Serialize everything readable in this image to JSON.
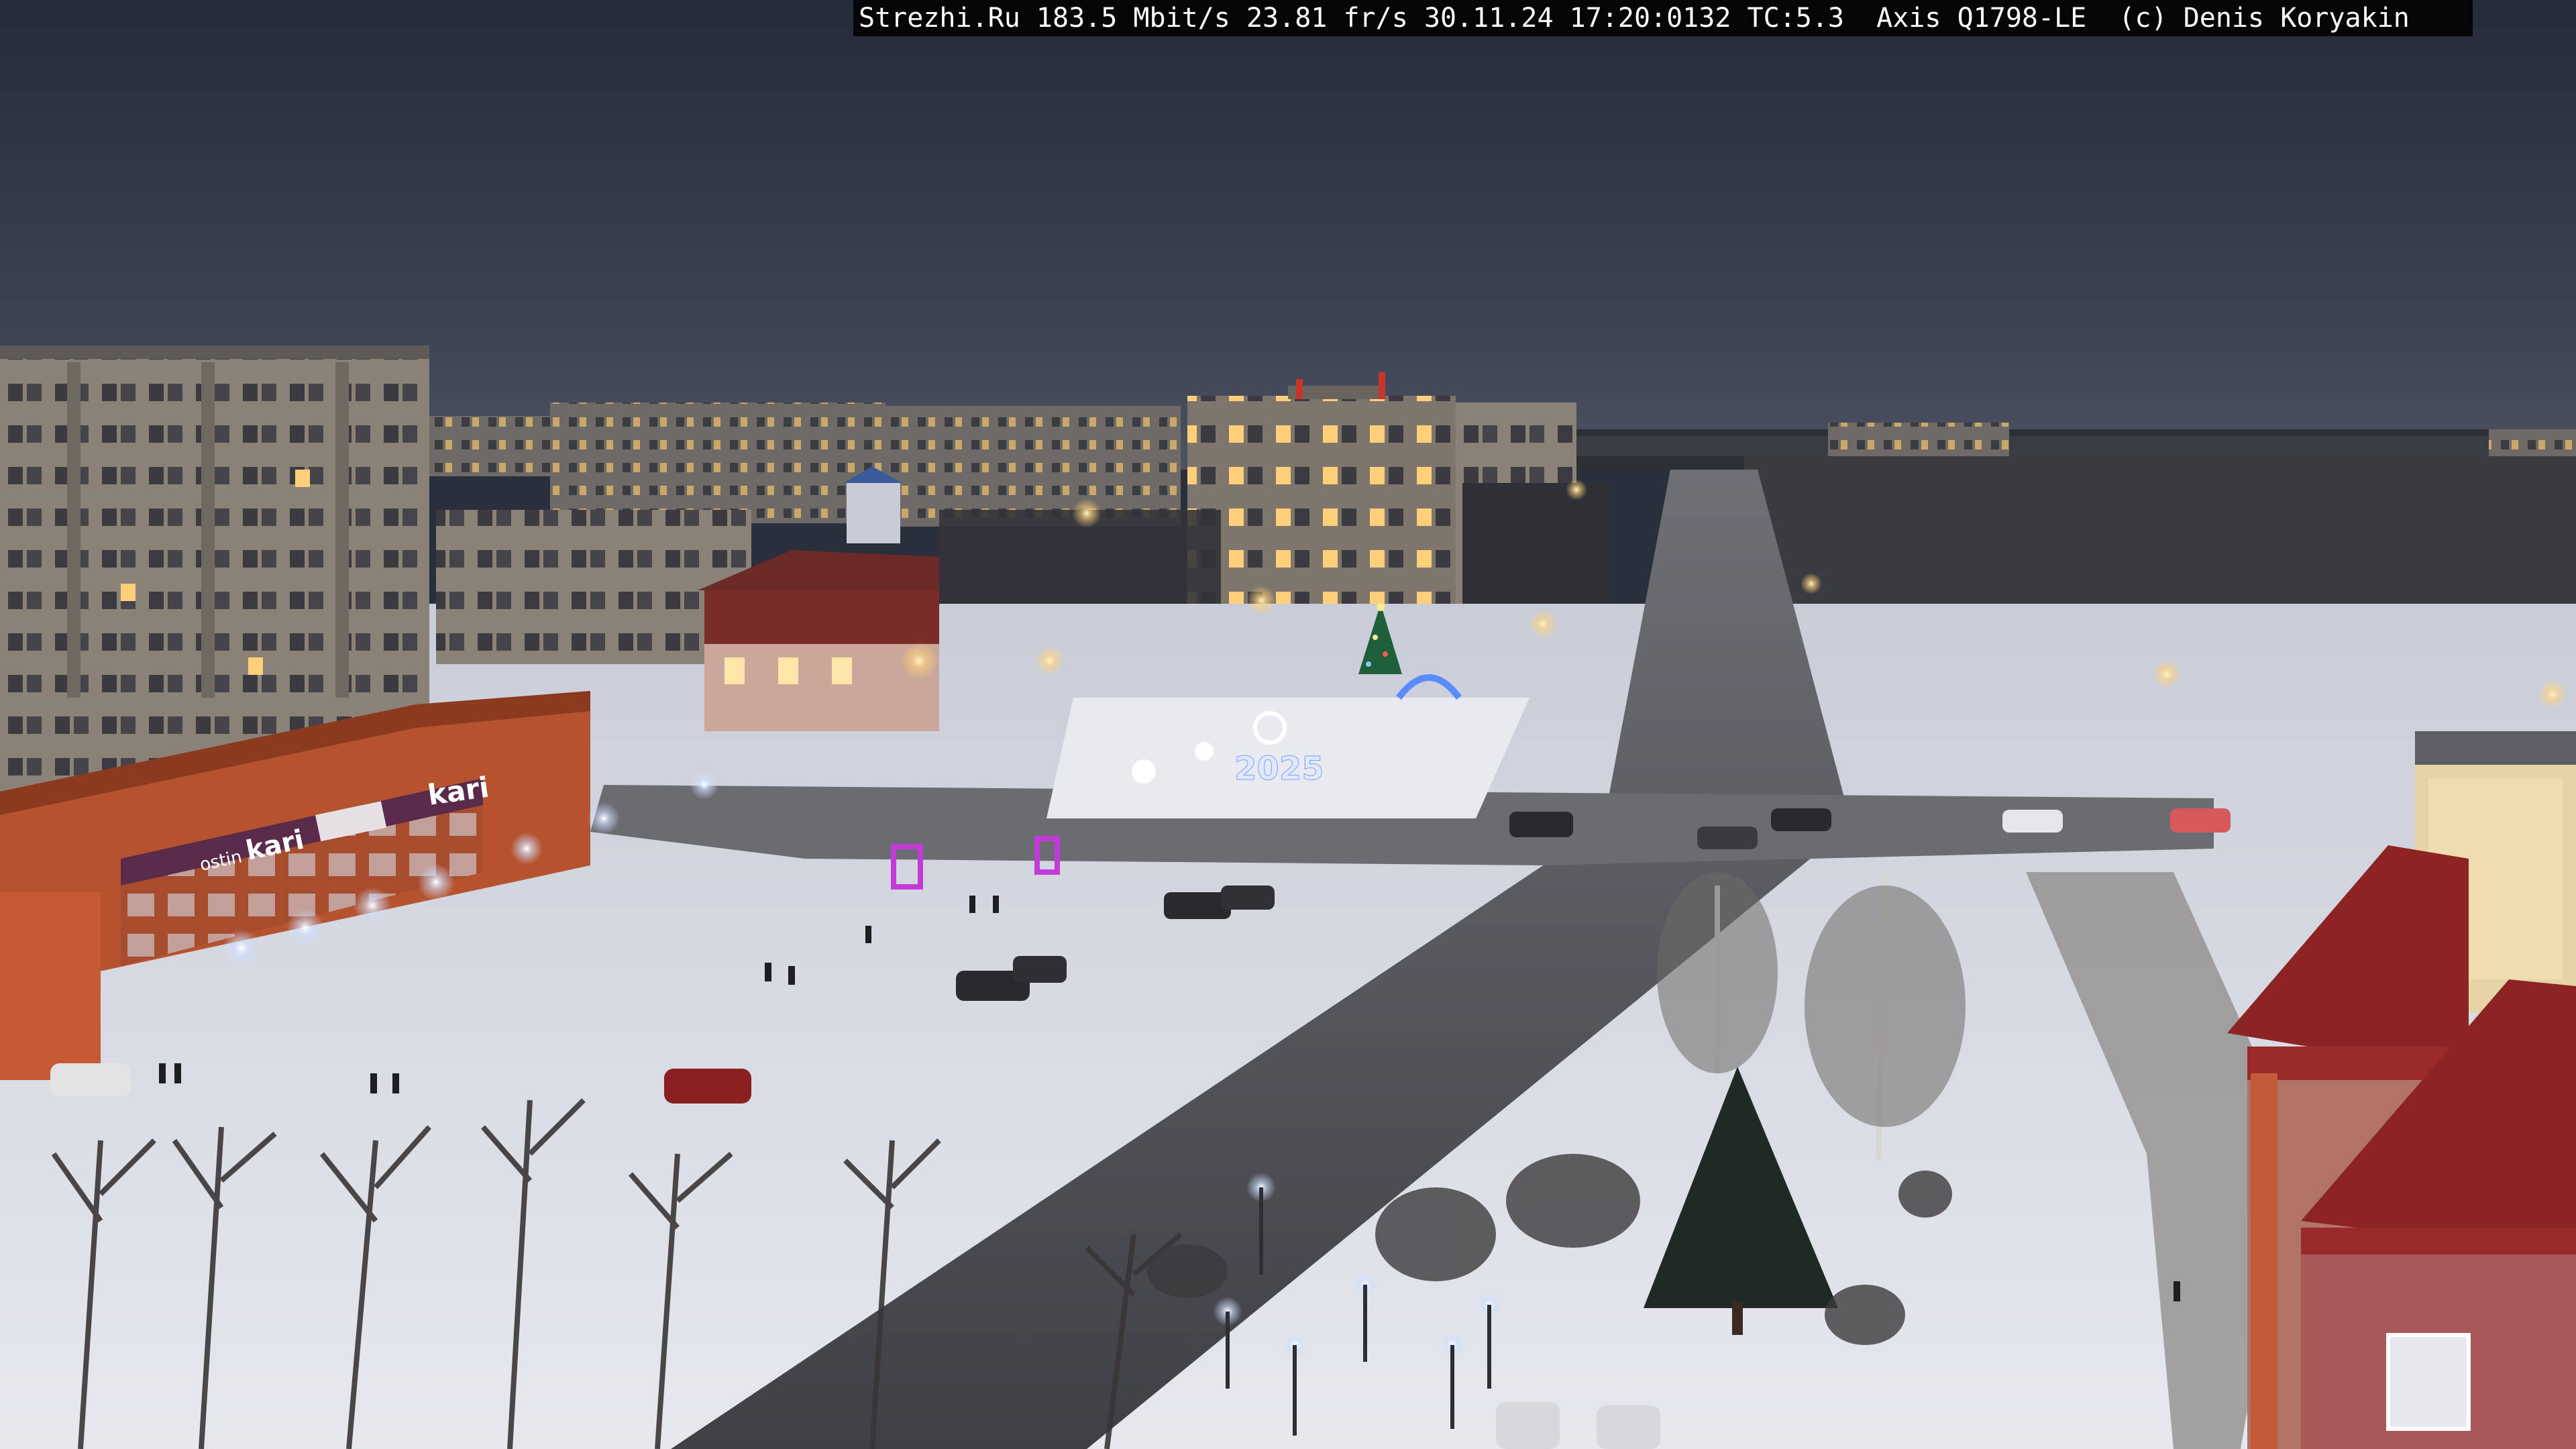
{
  "overlay": {
    "text": "Strezhi.Ru 183.5 Mbit/s 23.81 fr/s 30.11.24 17:20:0132 TC:5.3  Axis Q1798-LE  (c) Denis Koryakin"
  },
  "signs": {
    "shop_left": "ostin",
    "shop_mid": "kari",
    "shop_right": "kari",
    "year_display": "2025"
  },
  "colors": {
    "sky_top": "#2b303d",
    "sky_bottom": "#4a5060",
    "snow": "#dcdfe6",
    "road": "#4a4b52",
    "building_panel": "#8a8074",
    "shop_facade": "#b5532f",
    "roof_red": "#8c2424",
    "tree_dark": "#2a2a2e",
    "light_warm": "#ffd27a",
    "light_cool": "#eaf2ff",
    "neon_purple": "#c23bd8",
    "neon_blue": "#5a8cff"
  }
}
